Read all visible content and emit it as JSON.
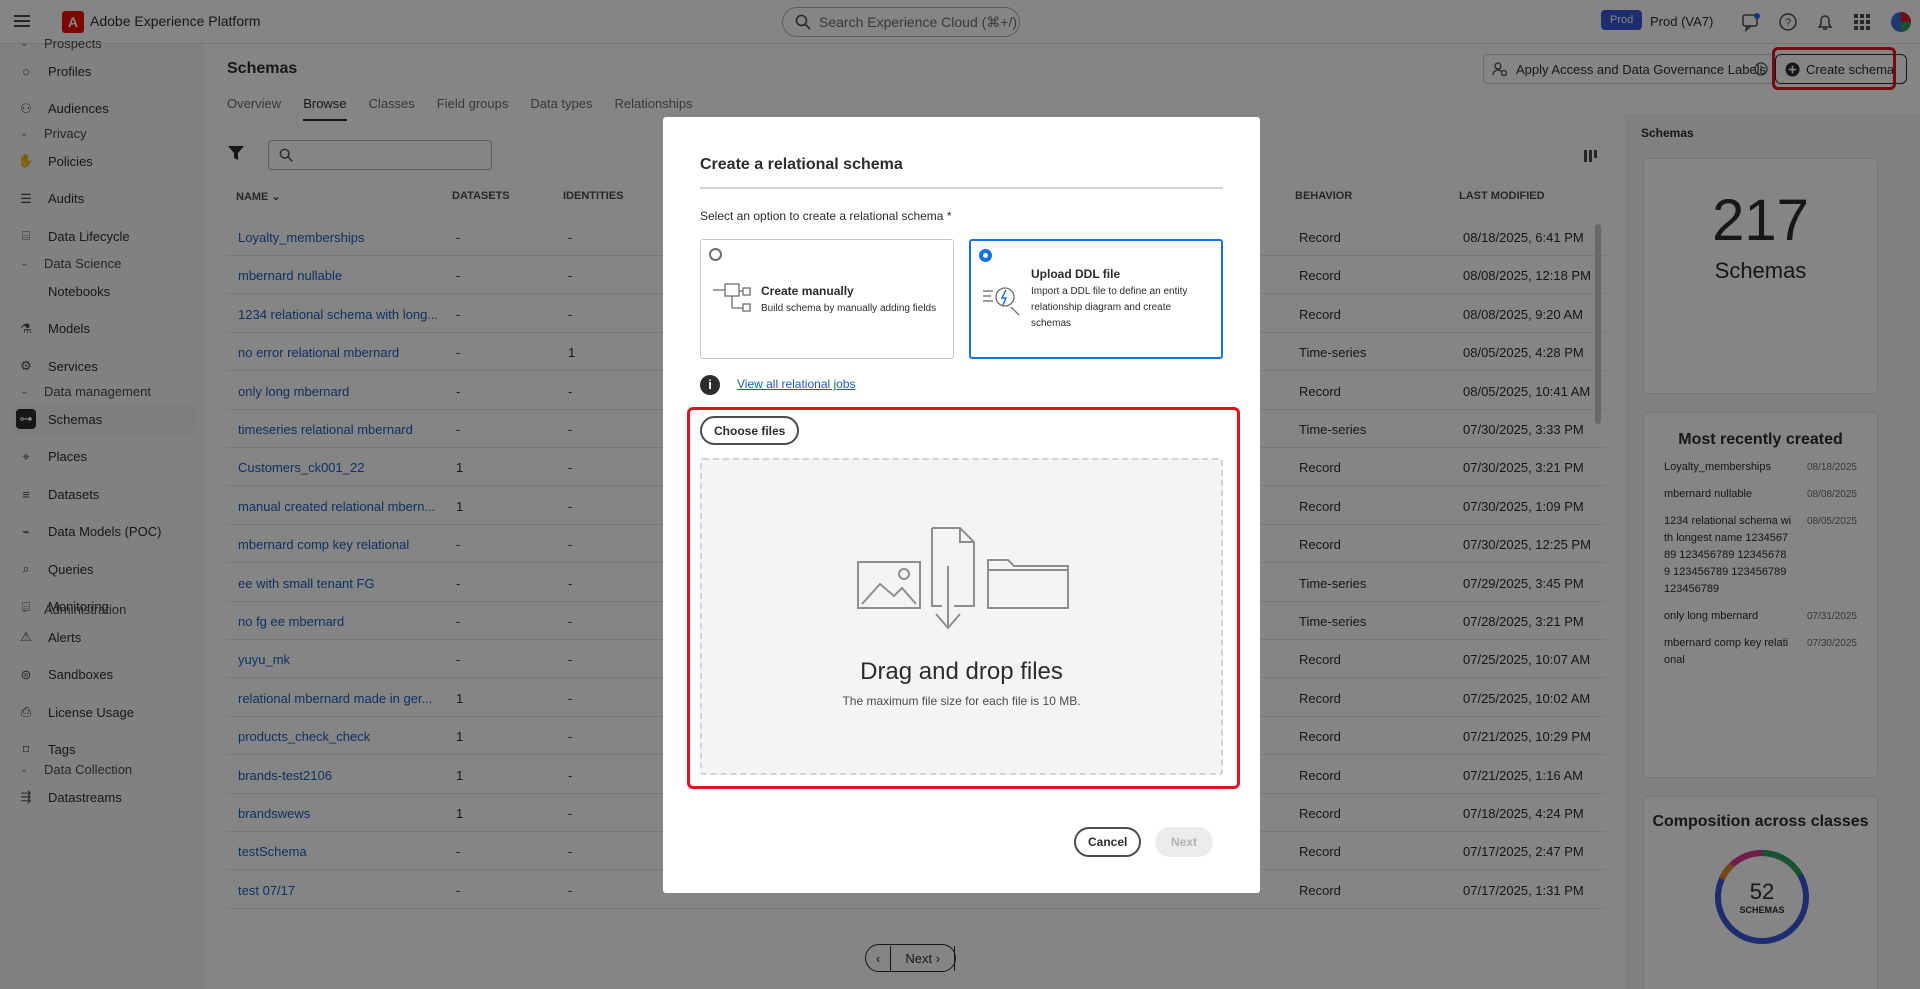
{
  "topbar": {
    "app_title": "Adobe Experience Platform",
    "search_placeholder": "Search Experience Cloud (⌘+/)",
    "org_badge": "Prod",
    "org_name": "Prod (VA7)"
  },
  "sidebar": {
    "items": [
      {
        "type": "section",
        "label": "Prospects"
      },
      {
        "type": "item",
        "label": "Profiles",
        "icon": "person-icon"
      },
      {
        "type": "item",
        "label": "Audiences",
        "icon": "audiences-icon"
      },
      {
        "type": "section",
        "label": "Privacy"
      },
      {
        "type": "item",
        "label": "Policies",
        "icon": "hand-icon"
      },
      {
        "type": "item",
        "label": "Audits",
        "icon": "audit-icon"
      },
      {
        "type": "item",
        "label": "Data Lifecycle",
        "icon": "lifecycle-icon"
      },
      {
        "type": "section",
        "label": "Data Science"
      },
      {
        "type": "item",
        "label": "Notebooks",
        "icon": "code-icon"
      },
      {
        "type": "item",
        "label": "Models",
        "icon": "flask-icon"
      },
      {
        "type": "item",
        "label": "Services",
        "icon": "services-icon"
      },
      {
        "type": "section",
        "label": "Data management"
      },
      {
        "type": "item",
        "label": "Schemas",
        "icon": "schema-icon",
        "active": true
      },
      {
        "type": "item",
        "label": "Places",
        "icon": "pin-icon"
      },
      {
        "type": "item",
        "label": "Datasets",
        "icon": "database-icon"
      },
      {
        "type": "item",
        "label": "Data Models (POC)",
        "icon": "data-models-icon"
      },
      {
        "type": "item",
        "label": "Queries",
        "icon": "queries-icon"
      },
      {
        "type": "item",
        "label": "Monitoring",
        "icon": "monitoring-icon"
      },
      {
        "type": "section",
        "label": "Administration"
      },
      {
        "type": "item",
        "label": "Alerts",
        "icon": "alert-icon"
      },
      {
        "type": "item",
        "label": "Sandboxes",
        "icon": "sandbox-icon"
      },
      {
        "type": "item",
        "label": "License Usage",
        "icon": "license-icon"
      },
      {
        "type": "item",
        "label": "Tags",
        "icon": "tag-icon"
      },
      {
        "type": "section",
        "label": "Data Collection"
      },
      {
        "type": "item",
        "label": "Datastreams",
        "icon": "datastreams-icon"
      }
    ]
  },
  "page": {
    "title": "Schemas",
    "tabs": [
      "Overview",
      "Browse",
      "Classes",
      "Field groups",
      "Data types",
      "Relationships"
    ],
    "active_tab": "Browse",
    "apply_labels": "Apply Access and Data Governance Labels",
    "create_schema": "Create schema"
  },
  "table": {
    "headers": {
      "name": "NAME",
      "datasets": "DATASETS",
      "identities": "IDENTITIES",
      "behavior": "BEHAVIOR",
      "last_modified": "LAST MODIFIED"
    },
    "rows": [
      {
        "name": "Loyalty_memberships",
        "datasets": "-",
        "identities": "-",
        "behavior": "Record",
        "modified": "08/18/2025, 6:41 PM"
      },
      {
        "name": "mbernard nullable",
        "datasets": "-",
        "identities": "-",
        "behavior": "Record",
        "modified": "08/08/2025, 12:18 PM"
      },
      {
        "name": "1234 relational schema with long...",
        "datasets": "-",
        "identities": "-",
        "behavior": "Record",
        "modified": "08/08/2025, 9:20 AM"
      },
      {
        "name": "no error relational mbernard",
        "datasets": "-",
        "identities": "1",
        "behavior": "Time-series",
        "modified": "08/05/2025, 4:28 PM"
      },
      {
        "name": "only long mbernard",
        "datasets": "-",
        "identities": "-",
        "behavior": "Record",
        "modified": "08/05/2025, 10:41 AM"
      },
      {
        "name": "timeseries relational mbernard",
        "datasets": "-",
        "identities": "-",
        "behavior": "Time-series",
        "modified": "07/30/2025, 3:33 PM"
      },
      {
        "name": "Customers_ck001_22",
        "datasets": "1",
        "identities": "-",
        "behavior": "Record",
        "modified": "07/30/2025, 3:21 PM"
      },
      {
        "name": "manual created relational mbern...",
        "datasets": "1",
        "identities": "-",
        "behavior": "Record",
        "modified": "07/30/2025, 1:09 PM"
      },
      {
        "name": "mbernard comp key relational",
        "datasets": "-",
        "identities": "-",
        "behavior": "Record",
        "modified": "07/30/2025, 12:25 PM"
      },
      {
        "name": "ee with small tenant FG",
        "datasets": "-",
        "identities": "-",
        "behavior": "Time-series",
        "modified": "07/29/2025, 3:45 PM"
      },
      {
        "name": "no fg ee mbernard",
        "datasets": "-",
        "identities": "-",
        "behavior": "Time-series",
        "modified": "07/28/2025, 3:21 PM"
      },
      {
        "name": "yuyu_mk",
        "datasets": "-",
        "identities": "-",
        "behavior": "Record",
        "modified": "07/25/2025, 10:07 AM"
      },
      {
        "name": "relational mbernard made in ger...",
        "datasets": "1",
        "identities": "-",
        "behavior": "Record",
        "modified": "07/25/2025, 10:02 AM"
      },
      {
        "name": "products_check_check",
        "datasets": "1",
        "identities": "-",
        "behavior": "Record",
        "modified": "07/21/2025, 10:29 PM"
      },
      {
        "name": "brands-test2106",
        "datasets": "1",
        "identities": "-",
        "behavior": "Record",
        "modified": "07/21/2025, 1:16 AM"
      },
      {
        "name": "brandswews",
        "datasets": "1",
        "identities": "-",
        "behavior": "Record",
        "modified": "07/18/2025, 4:24 PM"
      },
      {
        "name": "testSchema",
        "datasets": "-",
        "identities": "-",
        "behavior": "Record",
        "modified": "07/17/2025, 2:47 PM"
      },
      {
        "name": "test 07/17",
        "datasets": "-",
        "identities": "-",
        "behavior": "Record",
        "modified": "07/17/2025, 1:31 PM"
      }
    ]
  },
  "pager": {
    "next": "Next"
  },
  "right_panel": {
    "title": "Schemas",
    "total": "217",
    "total_label": "Schemas",
    "recent_title": "Most recently created",
    "recent": [
      {
        "name": "Loyalty_memberships",
        "date": "08/18/2025"
      },
      {
        "name": "mbernard nullable",
        "date": "08/08/2025"
      },
      {
        "name": "1234 relational schema with longest name 123456789 123456789 123456789 123456789 123456789 123456789",
        "date": "08/05/2025"
      },
      {
        "name": "only long mbernard",
        "date": "07/31/2025"
      },
      {
        "name": "mbernard comp key relational",
        "date": "07/30/2025"
      }
    ],
    "composition_title": "Composition across classes",
    "composition_value": "52",
    "composition_label": "SCHEMAS"
  },
  "modal": {
    "title": "Create a relational schema",
    "subtitle": "Select an option to create a relational schema",
    "required_mark": "*",
    "option_manual_title": "Create manually",
    "option_manual_desc": "Build schema by manually adding fields",
    "option_ddl_title": "Upload DDL file",
    "option_ddl_desc": "Import a DDL file to define an entity relationship diagram and create schemas",
    "selected_option": "Upload DDL file",
    "view_jobs_link": "View all relational jobs",
    "choose_files": "Choose files",
    "drop_title": "Drag and drop files",
    "drop_sub": "The maximum file size for each file is 10 MB.",
    "cancel": "Cancel",
    "next": "Next"
  },
  "colors": {
    "accent": "#1473e6",
    "highlight": "#e0141e",
    "link": "#1a5ebc",
    "org_badge": "#3a55d6",
    "brand": "#eb1000"
  }
}
